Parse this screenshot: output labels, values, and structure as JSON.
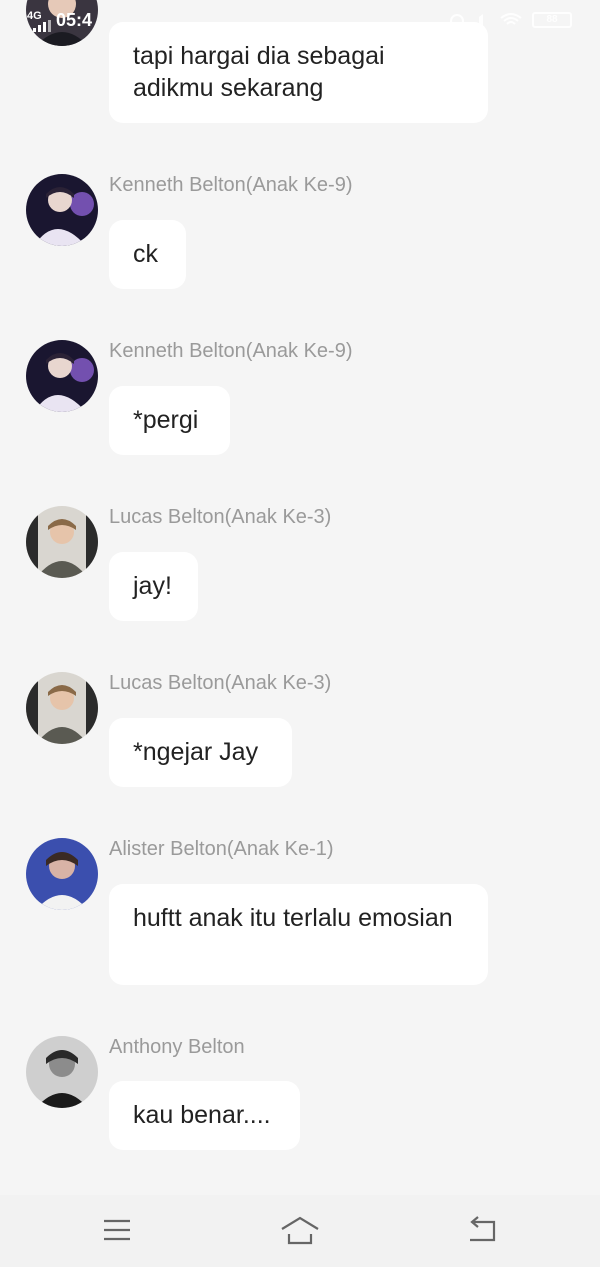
{
  "status_bar": {
    "network": "4G",
    "time": "05:4",
    "battery": "88"
  },
  "messages": [
    {
      "sender": "",
      "text": "tapi hargai dia sebagai adikmu sekarang",
      "avatar": "avatar-top-partial"
    },
    {
      "sender": "Kenneth Belton(Anak Ke-9)",
      "text": "ck",
      "avatar": "avatar-kenneth"
    },
    {
      "sender": "Kenneth Belton(Anak Ke-9)",
      "text": "*pergi",
      "avatar": "avatar-kenneth"
    },
    {
      "sender": "Lucas Belton(Anak Ke-3)",
      "text": "jay!",
      "avatar": "avatar-lucas"
    },
    {
      "sender": "Lucas Belton(Anak Ke-3)",
      "text": "*ngejar Jay",
      "avatar": "avatar-lucas"
    },
    {
      "sender": "Alister Belton(Anak Ke-1)",
      "text": "huftt anak itu terlalu emosian",
      "avatar": "avatar-alister"
    },
    {
      "sender": "Anthony Belton",
      "text": "kau benar....",
      "avatar": "avatar-anthony"
    }
  ],
  "nav": {
    "icons": [
      "menu-icon",
      "home-icon",
      "back-icon"
    ]
  },
  "colors": {
    "background": "#f5f5f5",
    "bubble": "#ffffff",
    "sender_name": "#9a9a9a",
    "message_text": "#222222"
  }
}
